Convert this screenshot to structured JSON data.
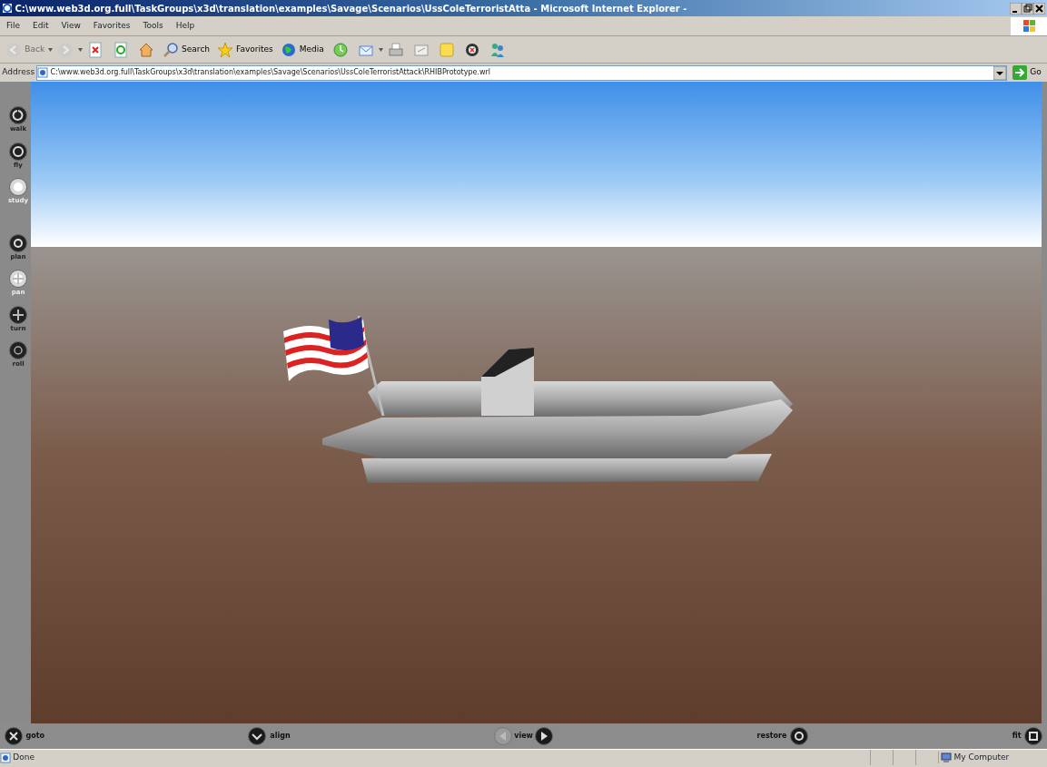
{
  "window": {
    "title": "C:\\www.web3d.org.full\\TaskGroups\\x3d\\translation\\examples\\Savage\\Scenarios\\UssColeTerroristAtta - Microsoft Internet Explorer -"
  },
  "menu": [
    "File",
    "Edit",
    "View",
    "Favorites",
    "Tools",
    "Help"
  ],
  "toolbar": [
    {
      "kind": "back",
      "label": "Back",
      "disabled": true
    },
    {
      "kind": "forward",
      "disabled": true
    },
    {
      "kind": "stop",
      "disabled": false
    },
    {
      "kind": "refresh",
      "disabled": false
    },
    {
      "kind": "home",
      "disabled": false
    },
    {
      "kind": "search",
      "label": "Search",
      "disabled": false
    },
    {
      "kind": "favorites",
      "label": "Favorites",
      "disabled": false
    },
    {
      "kind": "media",
      "label": "Media",
      "disabled": false
    },
    {
      "kind": "history",
      "disabled": false
    },
    {
      "kind": "mail",
      "disabled": false
    },
    {
      "kind": "print",
      "disabled": false
    },
    {
      "kind": "edit",
      "disabled": false
    },
    {
      "kind": "note",
      "disabled": false
    },
    {
      "kind": "research",
      "disabled": false
    },
    {
      "kind": "messenger",
      "disabled": false
    }
  ],
  "address": {
    "label": "Address",
    "value": "C:\\www.web3d.org.full\\TaskGroups\\x3d\\translation\\examples\\Savage\\Scenarios\\UssColeTerroristAttack\\RHIBPrototype.wrl",
    "go": "Go"
  },
  "viewer": {
    "modes": [
      {
        "label": "walk",
        "selected": false,
        "disabled": false
      },
      {
        "label": "fly",
        "selected": false,
        "disabled": false
      },
      {
        "label": "study",
        "selected": true,
        "disabled": false
      },
      {
        "label": "plan",
        "selected": false,
        "disabled": false
      },
      {
        "label": "pan",
        "selected": false,
        "disabled": true
      },
      {
        "label": "turn",
        "selected": false,
        "disabled": false
      },
      {
        "label": "roll",
        "selected": false,
        "disabled": false
      }
    ],
    "bottom": [
      {
        "kind": "goto",
        "label": "goto"
      },
      {
        "kind": "align",
        "label": "align"
      },
      {
        "kind": "view",
        "label": "view"
      },
      {
        "kind": "restore",
        "label": "restore"
      },
      {
        "kind": "fit",
        "label": "fit"
      }
    ]
  },
  "status_bar": {
    "text": "Done",
    "zone": "My Computer"
  }
}
